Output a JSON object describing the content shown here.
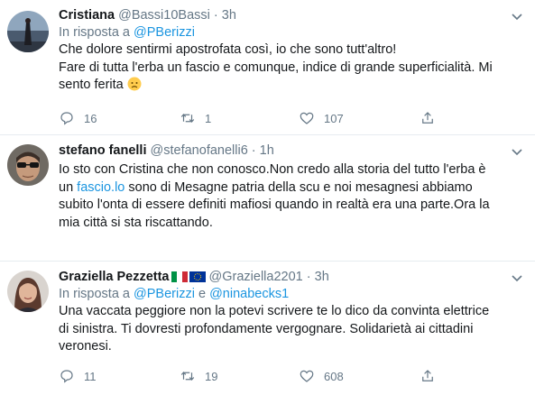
{
  "tweets": [
    {
      "name": "Cristiana",
      "handle": "@Bassi10Bassi",
      "dot": "·",
      "time": "3h",
      "reply_prefix": "In risposta a",
      "mentions": [
        "@PBerizzi"
      ],
      "lines": [
        "Che dolore sentirmi apostrofata così, io che sono tutt'altro!",
        "Fare di tutta l'erba un fascio e comunque, indice di grande superficialità. Mi",
        "sento ferita"
      ],
      "replies": "16",
      "retweets": "1",
      "likes": "107"
    },
    {
      "name": "stefano fanelli",
      "handle": "@stefanofanelli6",
      "dot": "·",
      "time": "1h",
      "line1": "Io sto con Cristina che non conosco.Non credo alla storia del tutto l'erba è",
      "line2_prefix": "un ",
      "line2_link": "fascio.lo",
      "line2_suffix": " sono di Mesagne patria della scu e noi mesagnesi abbiamo",
      "line3": "subito l'onta di essere definiti mafiosi  quando in realtà era una parte.Ora la",
      "line4": "mia città si sta riscattando."
    },
    {
      "name": "Graziella Pezzetta",
      "handle": "@Graziella2201",
      "dot": "·",
      "time": "3h",
      "reply_prefix": "In risposta a",
      "mentions": [
        "@PBerizzi",
        "@ninabecks1"
      ],
      "mention_joiner": "e",
      "lines": [
        "Una vaccata peggiore non la potevi scrivere te lo dico da convinta elettrice",
        "di sinistra. Ti dovresti profondamente vergognare. Solidarietà ai cittadini",
        "veronesi."
      ],
      "replies": "11",
      "retweets": "19",
      "likes": "608"
    }
  ],
  "colors": {
    "accent": "#1b95e0",
    "muted": "#657786",
    "border": "#e6ecf0"
  },
  "icons": [
    "reply-icon",
    "retweet-icon",
    "like-icon",
    "share-icon",
    "chevron-down-icon",
    "sad-face-emoji",
    "italy-flag",
    "eu-flag"
  ]
}
